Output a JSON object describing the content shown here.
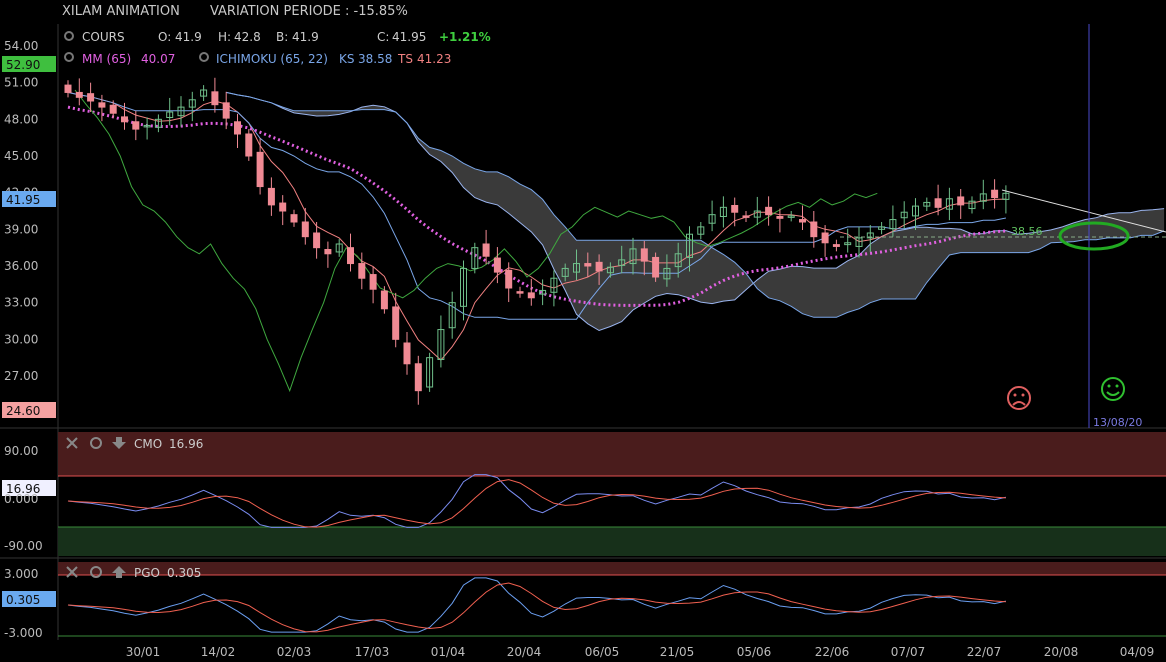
{
  "header": {
    "instrument": "XILAM ANIMATION",
    "variation": "VARIATION PERIODE : -15.85%"
  },
  "price_panel": {
    "ohlc": {
      "cours_label": "COURS",
      "open_label": "O:",
      "open": "41.9",
      "high_label": "H:",
      "high": "42.8",
      "low_label": "B:",
      "low": "41.9",
      "close_label": "C:",
      "close": "41.95",
      "change": "+1.21%"
    },
    "mm_label": "MM (65)",
    "mm_value": "40.07",
    "ichimoku_label": "ICHIMOKU (65, 22)",
    "ks_label": "KS",
    "ks_value": "38.58",
    "ts_label": "TS",
    "ts_value": "41.23",
    "price_tag": "41.95",
    "max_tag": "52.90",
    "min_tag": "24.60",
    "level_label": "38.56",
    "target_date": "13/08/20",
    "y_ticks": [
      "54.00",
      "51.00",
      "48.00",
      "45.00",
      "42.00",
      "39.00",
      "36.00",
      "33.00",
      "30.00",
      "27.00"
    ],
    "colors": {
      "up": "#6fbf8a",
      "down": "#f08a94",
      "mm": "#e060e0",
      "kijun": "#7aa6e8",
      "tenkan": "#f08080",
      "chikou": "#3fa83f",
      "cloud": "#3a3a3a",
      "max_tag": "#3fbf3f",
      "min_tag": "#f4a0a0",
      "price_tag": "#6aaaf0"
    }
  },
  "cmo_panel": {
    "label": "CMO",
    "value": "16.96",
    "tag": "16.96",
    "y_ticks": [
      "90.00",
      "0.000",
      "-90.00"
    ],
    "colors": {
      "fast": "#7a8cf0",
      "slow": "#f06050",
      "upper_zone": "#4a1c1c",
      "lower_zone": "#17301a"
    }
  },
  "pgo_panel": {
    "label": "PGO",
    "value": "0.305",
    "tag": "0.305",
    "y_ticks": [
      "3.000",
      "-3.000"
    ],
    "colors": {
      "fast": "#6a9ef0",
      "slow": "#f06050"
    }
  },
  "x_axis": {
    "labels": [
      "30/01",
      "14/02",
      "02/03",
      "17/03",
      "01/04",
      "20/04",
      "06/05",
      "21/05",
      "05/06",
      "22/06",
      "07/07",
      "22/07",
      "20/08",
      "04/09"
    ]
  },
  "chart_data": {
    "type": "candlestick",
    "x_labels": [
      "30/01",
      "14/02",
      "02/03",
      "17/03",
      "01/04",
      "20/04",
      "06/05",
      "21/05",
      "05/06",
      "22/06",
      "07/07",
      "22/07",
      "20/08",
      "04/09"
    ],
    "ylim": [
      24.0,
      55.0
    ],
    "close_series": [
      50.2,
      49.8,
      49.5,
      49.0,
      48.5,
      47.8,
      47.2,
      47.5,
      48.0,
      48.6,
      49.0,
      49.6,
      50.4,
      49.2,
      48.1,
      46.8,
      45.0,
      42.5,
      41.0,
      40.5,
      39.6,
      38.4,
      37.5,
      37.0,
      37.8,
      36.2,
      35.0,
      34.1,
      32.5,
      30.0,
      28.0,
      25.8,
      28.5,
      30.8,
      33.0,
      35.8,
      37.5,
      36.8,
      35.5,
      34.2,
      33.8,
      33.4,
      34.0,
      35.0,
      35.8,
      36.2,
      36.0,
      35.6,
      35.9,
      36.5,
      37.4,
      36.4,
      35.1,
      35.8,
      37.0,
      38.6,
      39.2,
      40.2,
      40.8,
      40.4,
      40.0,
      40.5,
      40.2,
      39.9,
      40.1,
      39.6,
      38.4,
      37.9,
      37.6,
      37.9,
      38.3,
      38.7,
      39.2,
      39.8,
      40.4,
      40.9,
      41.2,
      40.8,
      41.5,
      41.0,
      41.3,
      41.9,
      41.6,
      41.95
    ],
    "indicators": {
      "mm65_last": 40.07,
      "kijun_last": 38.58,
      "tenkan_last": 41.23,
      "level": 38.56
    },
    "cmo_last": 16.96,
    "cmo_ylim": [
      -120,
      120
    ],
    "pgo_last": 0.305,
    "pgo_ylim": [
      -3.5,
      4.0
    ]
  }
}
